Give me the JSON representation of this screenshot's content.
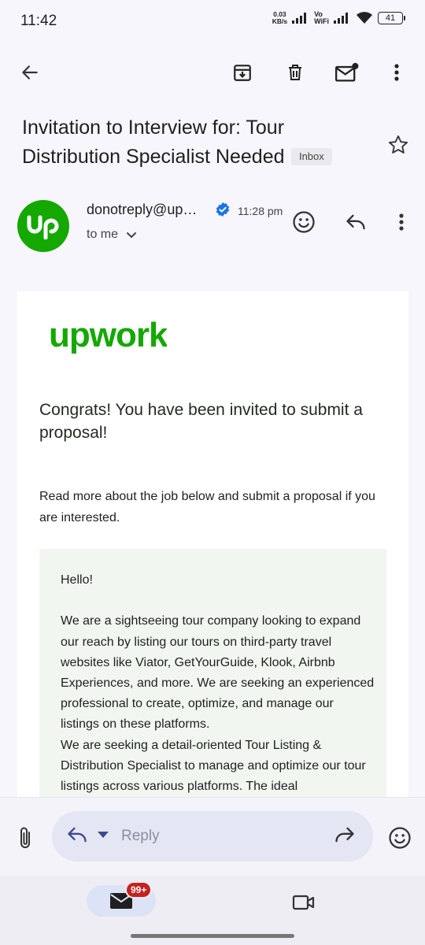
{
  "status_bar": {
    "time": "11:42",
    "speed_value": "0.03",
    "speed_unit": "KB/s",
    "vowifi_top": "Vo",
    "vowifi_bottom": "WiFi",
    "battery": "41"
  },
  "toolbar": {
    "back_icon": "arrow-left-icon",
    "archive_icon": "archive-icon",
    "delete_icon": "trash-icon",
    "mark_unread_icon": "mail-unread-icon",
    "more_icon": "more-vert-icon"
  },
  "email": {
    "subject": "Invitation to Interview for: Tour Distribution Specialist Needed",
    "label_chip": "Inbox",
    "sender": "donotreply@up…",
    "time": "11:28 pm",
    "recipient": "to me",
    "avatar_text": "up"
  },
  "body": {
    "logo_text": "upwork",
    "congrats": "Congrats! You have been invited to submit a proposal!",
    "read_more": "Read more about the job below and submit a proposal if you are interested.",
    "job_paragraphs": [
      "Hello!",
      "",
      "We are a sightseeing tour company looking to expand our reach by listing our tours on third-party travel websites like Viator, GetYourGuide, Klook, Airbnb Experiences, and more. We are seeking an experienced professional to create, optimize, and manage our listings on these platforms.",
      "We are seeking a detail-oriented Tour Listing & Distribution Specialist to manage and optimize our tour listings across various platforms. The ideal"
    ]
  },
  "reply_bar": {
    "placeholder": "Reply"
  },
  "nav": {
    "mail_badge": "99+"
  },
  "colors": {
    "upwork_green": "#14a800",
    "verified_blue": "#1a73e8",
    "badge_red": "#c5221f",
    "job_box_bg": "#f1f6f0"
  }
}
